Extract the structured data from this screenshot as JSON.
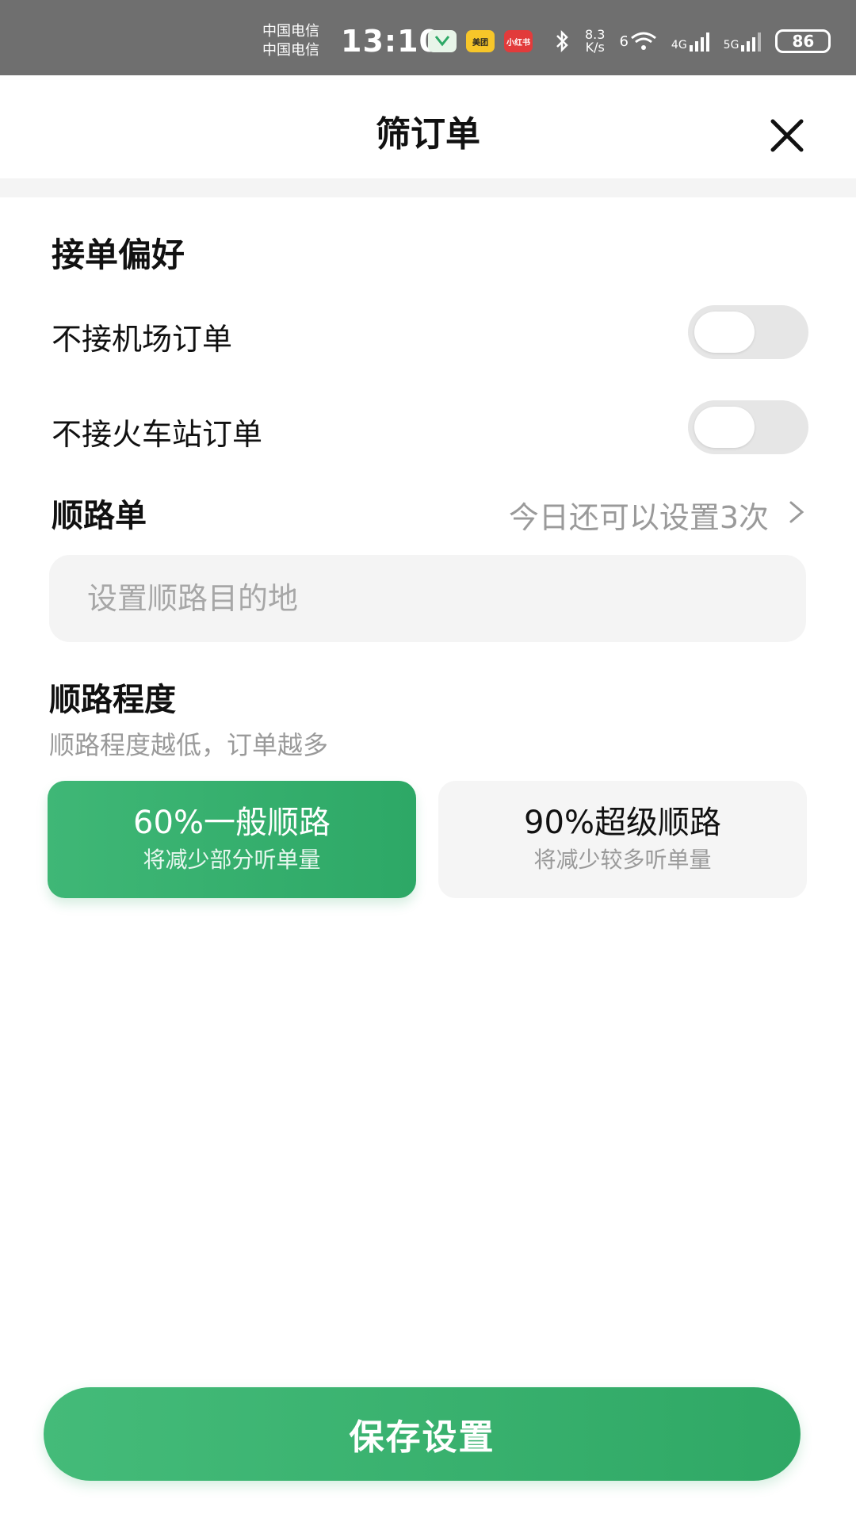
{
  "status_bar": {
    "carrier_1": "中国电信",
    "carrier_2": "中国电信",
    "time": "13:10",
    "app_icons": [
      "wechat-like-icon",
      "meituan-icon",
      "xiaohongshu-icon"
    ],
    "meituan_label": "美团",
    "xiaohongshu_label": "小红书",
    "speed_value": "8.3",
    "speed_unit": "K/s",
    "wifi_label": "6",
    "signal_1_label": "4G",
    "signal_2_label": "5G",
    "battery": "86"
  },
  "header": {
    "title": "筛订单"
  },
  "preferences": {
    "section_title": "接单偏好",
    "items": [
      {
        "label": "不接机场订单",
        "enabled": false
      },
      {
        "label": "不接火车站订单",
        "enabled": false
      }
    ]
  },
  "route": {
    "title": "顺路单",
    "remaining": "今日还可以设置3次",
    "input_placeholder": "设置顺路目的地"
  },
  "route_degree": {
    "title": "顺路程度",
    "subtitle": "顺路程度越低，订单越多",
    "options": [
      {
        "main": "60%一般顺路",
        "sub": "将减少部分听单量",
        "selected": true
      },
      {
        "main": "90%超级顺路",
        "sub": "将减少较多听单量",
        "selected": false
      }
    ]
  },
  "actions": {
    "save_label": "保存设置"
  },
  "colors": {
    "accent_green": "#3fb776",
    "status_bar_bg": "#6f6f6f",
    "toggle_off": "#e6e6e6"
  }
}
